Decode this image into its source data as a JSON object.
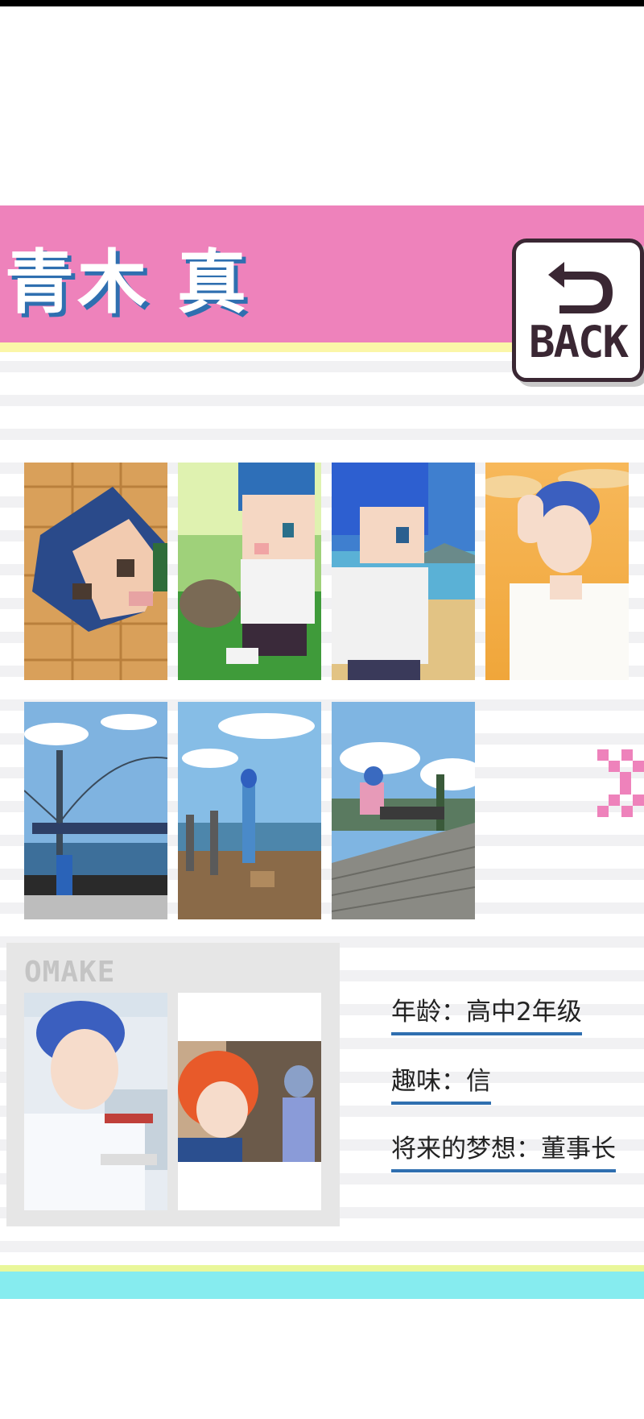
{
  "profile": {
    "name": "青木 真",
    "back_label": "BACK"
  },
  "gallery": {
    "items": [
      {
        "name": "gallery-thumb-1",
        "desc": "pixel face on wood floor"
      },
      {
        "name": "gallery-thumb-2",
        "desc": "pixel boy with cat"
      },
      {
        "name": "gallery-thumb-3",
        "desc": "pixel boy at beach"
      },
      {
        "name": "gallery-thumb-4",
        "desc": "anime boy sunset"
      },
      {
        "name": "gallery-thumb-5",
        "desc": "bridge photo"
      },
      {
        "name": "gallery-thumb-6",
        "desc": "pier photo"
      },
      {
        "name": "gallery-thumb-7",
        "desc": "boardwalk photo"
      }
    ]
  },
  "omake": {
    "label": "OMAKE"
  },
  "info": {
    "age": "年龄：高中2年级",
    "hobby": "趣味：信",
    "dream": "将来的梦想：董事长"
  },
  "colors": {
    "header_pink": "#ee82bb",
    "name_shadow_blue": "#2f6fb0",
    "accent_yellow": "#fbf6a8",
    "footer_cyan": "#86ecef",
    "back_border": "#3a2733",
    "next_arrow_pink": "#ee82bb"
  },
  "icons": {
    "back": "back-arrow-icon",
    "next": "chevron-right-icon"
  }
}
